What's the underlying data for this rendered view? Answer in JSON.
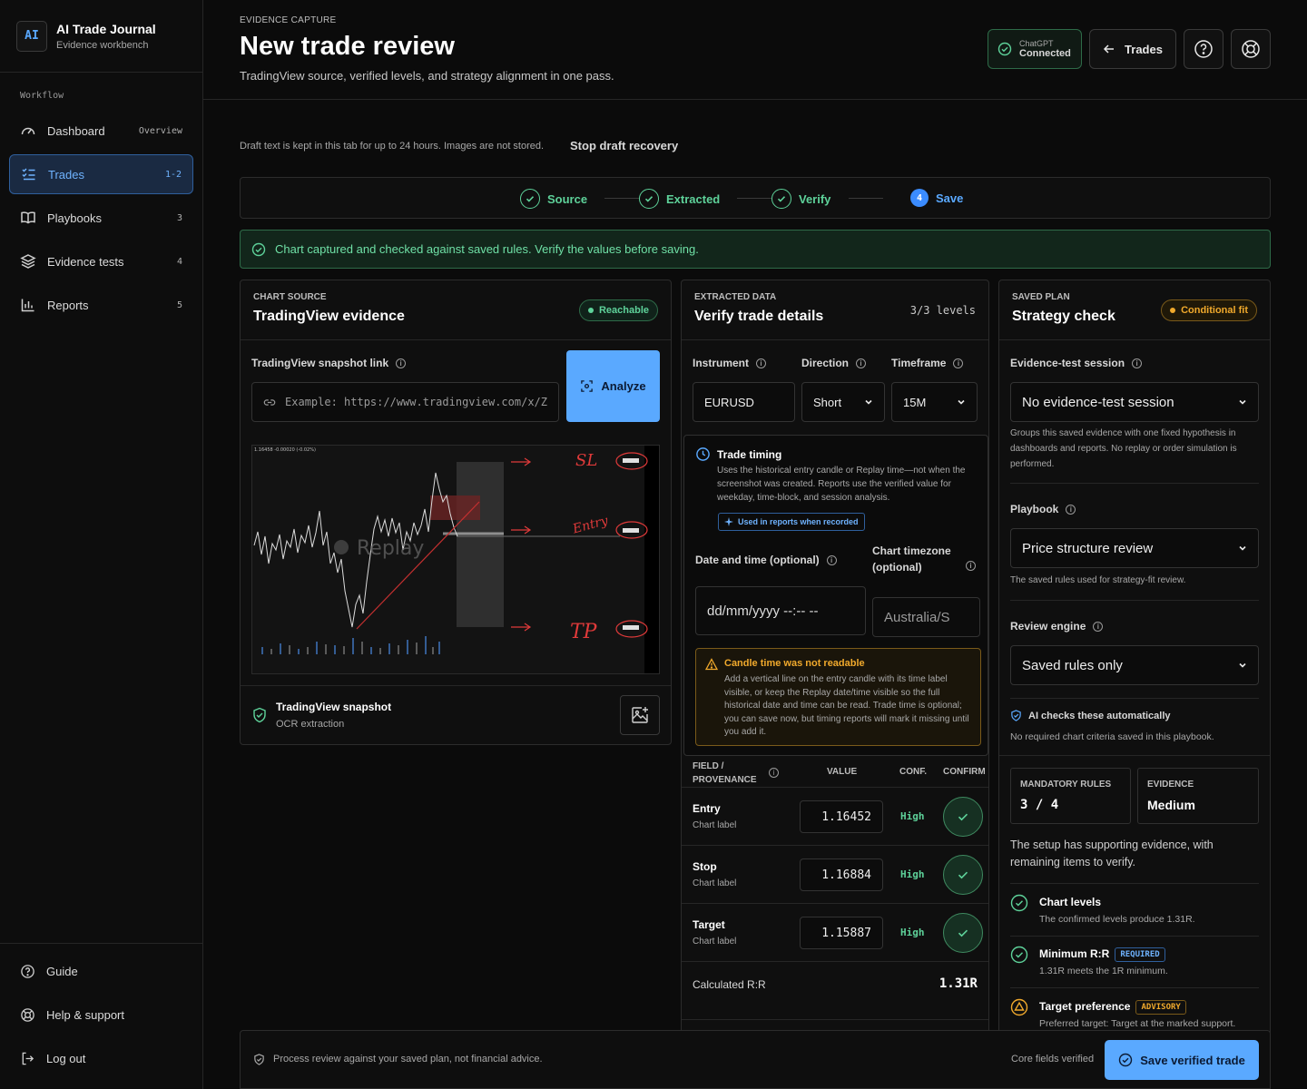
{
  "brand": {
    "logo": "AI",
    "title": "AI Trade Journal",
    "subtitle": "Evidence workbench"
  },
  "sidebar": {
    "section_label": "Workflow",
    "items": [
      {
        "label": "Dashboard",
        "meta": "Overview",
        "icon": "gauge-icon"
      },
      {
        "label": "Trades",
        "meta": "1-2",
        "icon": "list-check-icon",
        "active": true
      },
      {
        "label": "Playbooks",
        "meta": "3",
        "icon": "book-icon"
      },
      {
        "label": "Evidence tests",
        "meta": "4",
        "icon": "layers-icon"
      },
      {
        "label": "Reports",
        "meta": "5",
        "icon": "bar-chart-icon"
      }
    ],
    "bottom": [
      {
        "label": "Guide",
        "icon": "help-circle-icon"
      },
      {
        "label": "Help & support",
        "icon": "lifebuoy-icon"
      },
      {
        "label": "Log out",
        "icon": "logout-icon"
      }
    ]
  },
  "header": {
    "eyebrow": "EVIDENCE CAPTURE",
    "title": "New trade review",
    "subtitle": "TradingView source, verified levels, and strategy alignment in one pass.",
    "chatgpt_label": "ChatGPT",
    "chatgpt_status": "Connected",
    "trades_button": "Trades"
  },
  "draft": {
    "note": "Draft text is kept in this tab for up to 24 hours. Images are not stored.",
    "stop_button": "Stop draft recovery"
  },
  "stepper": {
    "steps": [
      {
        "label": "Source",
        "state": "done"
      },
      {
        "label": "Extracted",
        "state": "done"
      },
      {
        "label": "Verify",
        "state": "done"
      },
      {
        "label": "Save",
        "number": "4",
        "state": "current"
      }
    ]
  },
  "alert": {
    "text": "Chart captured and checked against saved rules. Verify the values before saving."
  },
  "chart_source": {
    "eyebrow": "CHART SOURCE",
    "title": "TradingView evidence",
    "status": "Reachable",
    "link_label": "TradingView snapshot link",
    "link_placeholder": "Example: https://www.tradingview.com/x/Z",
    "analyze_button": "Analyze",
    "snapshot_title": "TradingView snapshot",
    "snapshot_sub": "OCR extraction",
    "chart_header": "1.16458 -0.00020 (-0.02%)",
    "chart_watermark": "Replay",
    "annotations": [
      "SL",
      "Entry",
      "TP"
    ]
  },
  "extracted": {
    "eyebrow": "EXTRACTED DATA",
    "title": "Verify trade details",
    "levels": "3/3 levels",
    "instrument_label": "Instrument",
    "instrument": "EURUSD",
    "direction_label": "Direction",
    "direction": "Short",
    "timeframe_label": "Timeframe",
    "timeframe": "15M",
    "timing_title": "Trade timing",
    "timing_desc": "Uses the historical entry candle or Replay time—not when the screenshot was created. Reports use the verified value for weekday, time-block, and session analysis.",
    "timing_badge": "Used in reports when recorded",
    "date_label": "Date and time (optional)",
    "date_placeholder": "dd/mm/yyyy --:-- --",
    "tz_label": "Chart timezone (optional)",
    "tz_value": "Australia/S",
    "warn_title": "Candle time was not readable",
    "warn_text": "Add a vertical line on the entry candle with its time label visible, or keep the Replay date/time visible so the full historical date and time can be read. Trade time is optional; you can save now, but timing reports will mark it missing until you add it.",
    "table_head": {
      "field": "FIELD / PROVENANCE",
      "value": "VALUE",
      "conf": "CONF.",
      "confirm": "CONFIRM"
    },
    "rows": [
      {
        "field": "Entry",
        "prov": "Chart label",
        "value": "1.16452",
        "conf": "High"
      },
      {
        "field": "Stop",
        "prov": "Chart label",
        "value": "1.16884",
        "conf": "High"
      },
      {
        "field": "Target",
        "prov": "Chart label",
        "value": "1.15887",
        "conf": "High"
      }
    ],
    "rr_label": "Calculated R:R",
    "rr_value": "1.31R"
  },
  "plan": {
    "eyebrow": "SAVED PLAN",
    "title": "Strategy check",
    "status": "Conditional fit",
    "session_label": "Evidence-test session",
    "session_value": "No evidence-test session",
    "session_help": "Groups this saved evidence with one fixed hypothesis in dashboards and reports. No replay or order simulation is performed.",
    "playbook_label": "Playbook",
    "playbook_value": "Price structure review",
    "playbook_help": "The saved rules used for strategy-fit review.",
    "engine_label": "Review engine",
    "engine_value": "Saved rules only",
    "ai_title": "AI checks these automatically",
    "ai_text": "No required chart criteria saved in this playbook.",
    "mandatory_label": "MANDATORY RULES",
    "mandatory_value": "3 / 4",
    "evidence_label": "EVIDENCE",
    "evidence_value": "Medium",
    "summary": "The setup has supporting evidence, with remaining items to verify.",
    "checks": [
      {
        "title": "Chart levels",
        "text": "The confirmed levels produce 1.31R.",
        "state": "ok"
      },
      {
        "title": "Minimum R:R",
        "badge": "REQUIRED",
        "text": "1.31R meets the 1R minimum.",
        "state": "ok"
      },
      {
        "title": "Target preference",
        "badge": "ADVISORY",
        "text": "Preferred target: Target at the marked support.",
        "state": "warn"
      }
    ]
  },
  "footer": {
    "disclaimer": "Process review against your saved plan, not financial advice.",
    "status": "Core fields verified",
    "save_button": "Save verified trade"
  },
  "colors": {
    "accent": "#5aa9ff",
    "success": "#5ed29a",
    "warning": "#f0a92c",
    "danger": "#e03a3a"
  }
}
